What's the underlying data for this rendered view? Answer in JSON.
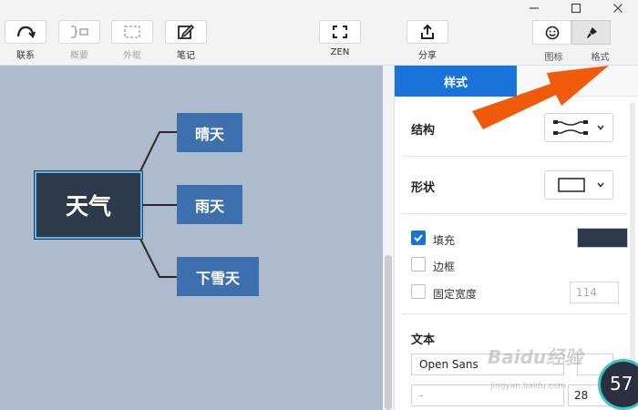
{
  "toolbar": {
    "buttons": [
      {
        "label": "联系",
        "icon": "relationship-arrow-icon"
      },
      {
        "label": "概要",
        "icon": "summary-bracket-icon"
      },
      {
        "label": "外框",
        "icon": "boundary-frame-icon"
      },
      {
        "label": "笔记",
        "icon": "note-pen-icon"
      },
      {
        "label": "ZEN",
        "icon": "fullscreen-icon"
      },
      {
        "label": "分享",
        "icon": "share-upload-icon"
      }
    ],
    "segmented": [
      {
        "label": "图标",
        "icon": "smiley-icon"
      },
      {
        "label": "格式",
        "icon": "paint-brush-icon"
      }
    ]
  },
  "mindmap": {
    "root": "天气",
    "children": [
      "晴天",
      "雨天",
      "下雪天"
    ]
  },
  "panel": {
    "tab_label": "样式",
    "structure_label": "结构",
    "shape_label": "形状",
    "options": [
      {
        "label": "填充",
        "checked": true
      },
      {
        "label": "边框",
        "checked": false
      },
      {
        "label": "固定宽度",
        "checked": false
      }
    ],
    "fill_color": "#2c3a4b",
    "width_placeholder": "114",
    "text_label": "文本",
    "font_family": "Open Sans",
    "font_weight": "-",
    "font_size": "28"
  },
  "overlay": {
    "watermark": "Baidu经验",
    "watermark_url": "jingyan.baidu.com",
    "gauge_value": "57"
  },
  "colors": {
    "accent": "#1a73d9",
    "canvas": "#aebbcd",
    "root_node": "#2c3a4b",
    "child_node": "#3e6fae",
    "arrow": "#f05a0a"
  }
}
